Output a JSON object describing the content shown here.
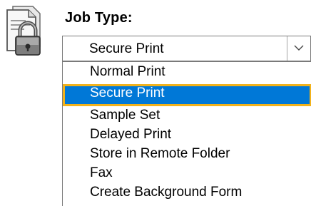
{
  "field": {
    "label": "Job Type:",
    "selected_value": "Secure Print"
  },
  "icons": {
    "document_lock": "document-padlock-icon",
    "dropdown_arrow": "chevron-down-icon"
  },
  "colors": {
    "highlight_background": "#0078d7",
    "highlight_outline": "#f2b21b"
  },
  "options": [
    {
      "label": "Normal Print"
    },
    {
      "label": "Secure Print",
      "selected": true
    },
    {
      "label": "Sample Set"
    },
    {
      "label": "Delayed Print"
    },
    {
      "label": "Store in Remote Folder"
    },
    {
      "label": "Fax"
    },
    {
      "label": "Create Background Form"
    }
  ]
}
